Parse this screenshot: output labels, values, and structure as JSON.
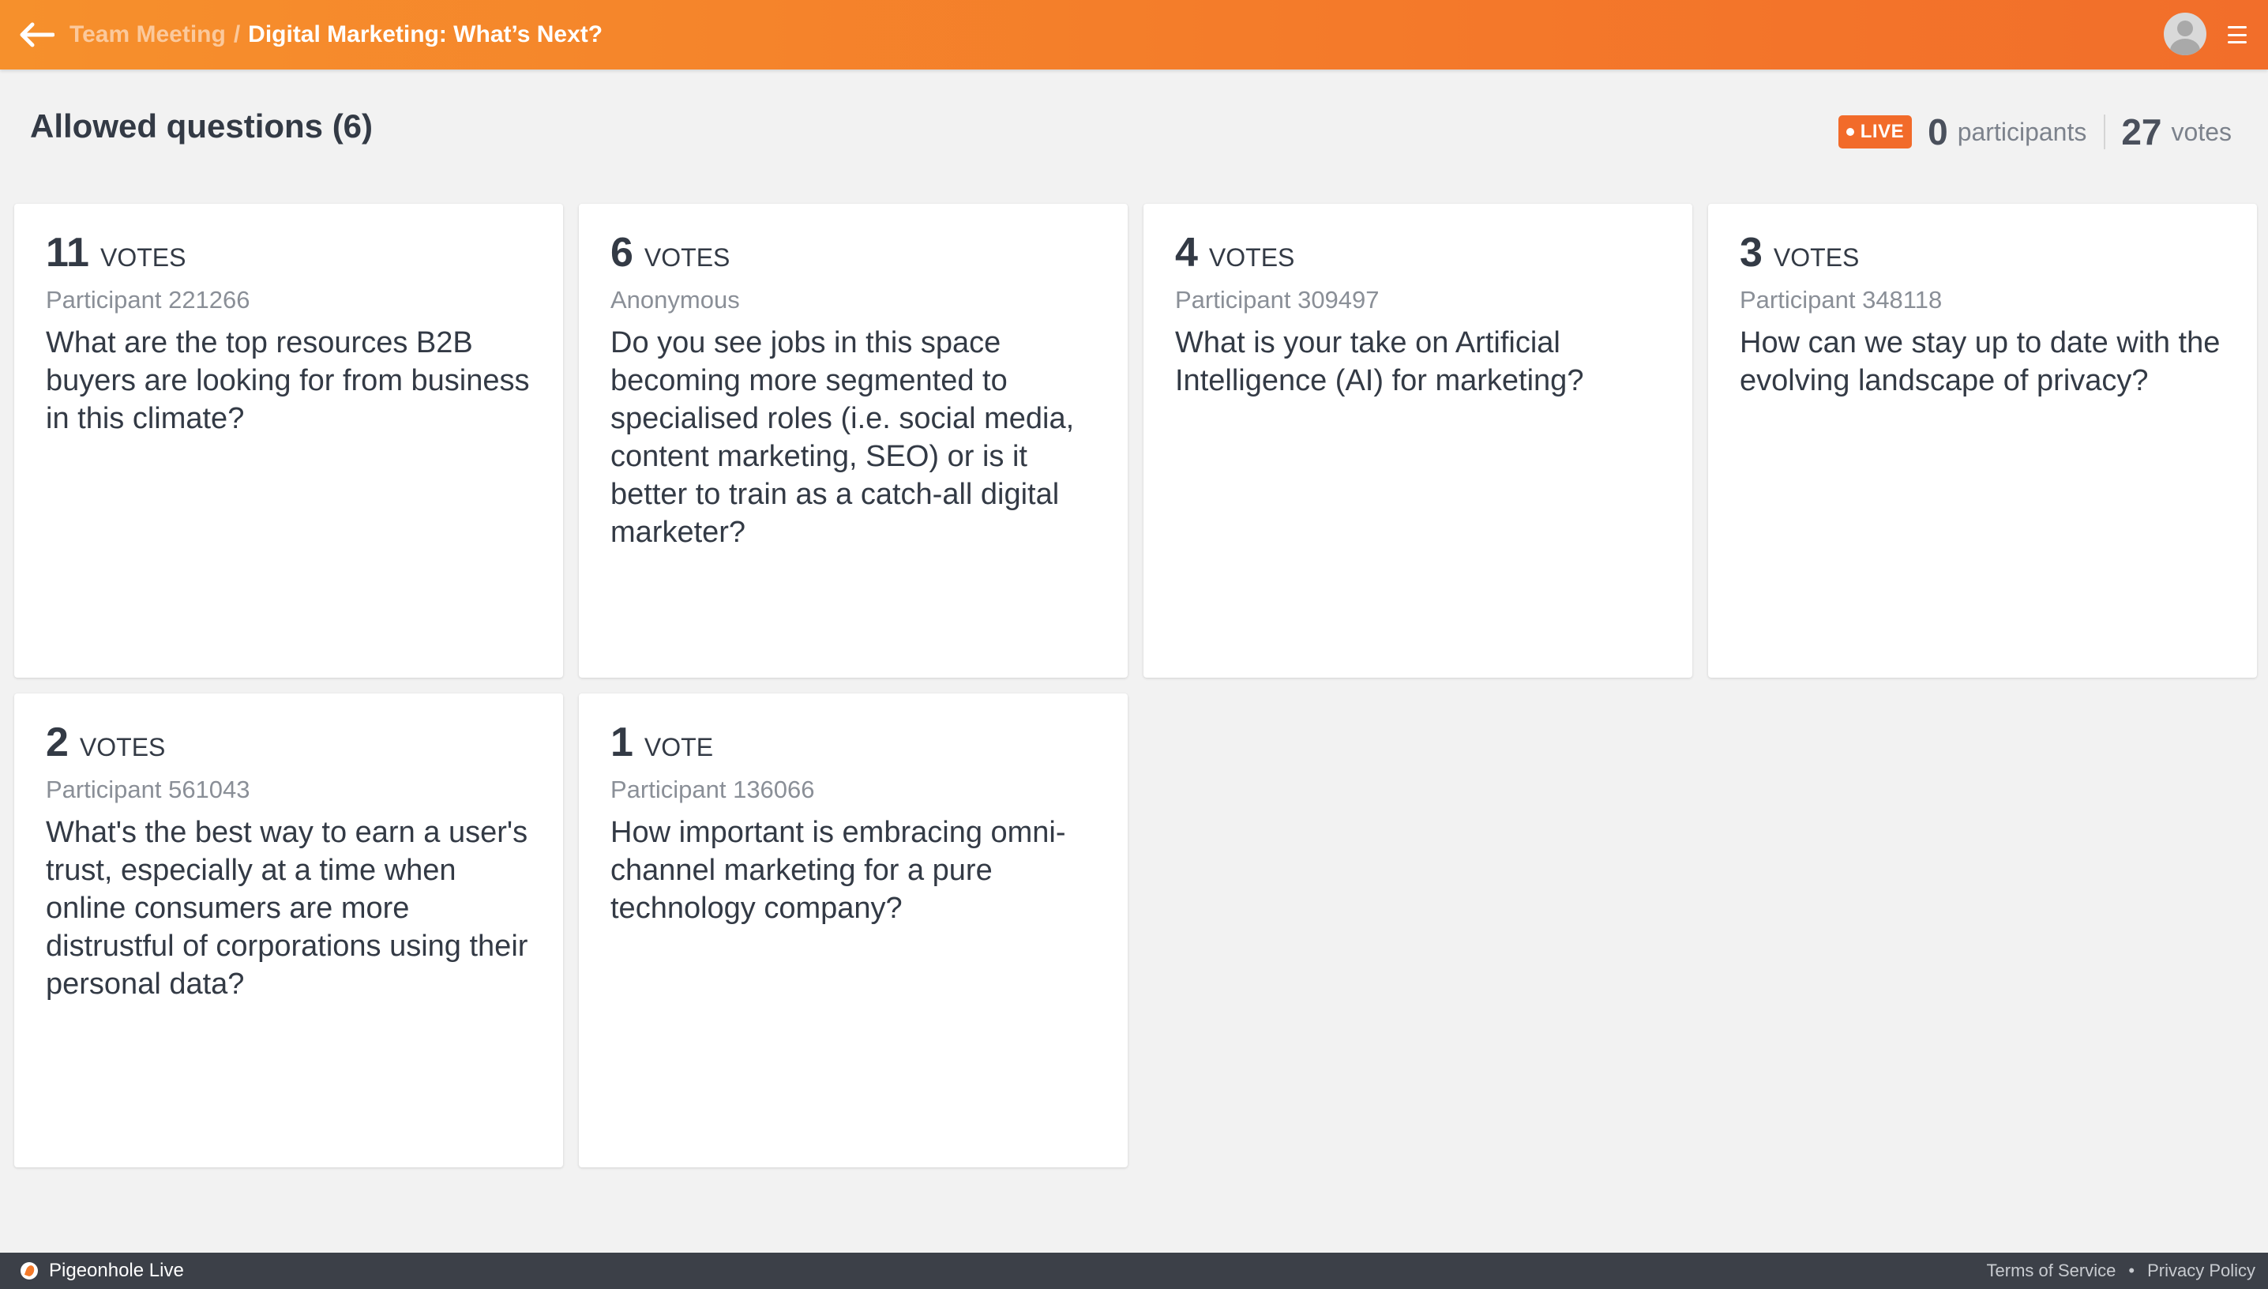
{
  "header": {
    "back_icon": "arrow-left-icon",
    "breadcrumb_parent": "Team Meeting",
    "breadcrumb_separator": "/",
    "breadcrumb_current": "Digital Marketing: What’s Next?",
    "avatar_icon": "user-avatar-icon",
    "menu_icon": "hamburger-menu-icon"
  },
  "section": {
    "title": "Allowed questions (6)"
  },
  "stats": {
    "live_label": "LIVE",
    "participants_count": "0",
    "participants_label": "participants",
    "votes_count": "27",
    "votes_label": "votes"
  },
  "questions": [
    {
      "votes": "11",
      "votes_label": "VOTES",
      "author": "Participant 221266",
      "text": "What are the top resources B2B buyers are looking for from business in this climate?"
    },
    {
      "votes": "6",
      "votes_label": "VOTES",
      "author": "Anonymous",
      "text": "Do you see jobs in this space becoming more segmented to specialised roles (i.e. social media, content marketing, SEO) or is it better to train as a catch-all digital marketer?"
    },
    {
      "votes": "4",
      "votes_label": "VOTES",
      "author": "Participant 309497",
      "text": "What is your take on Artificial Intelligence (AI) for marketing?"
    },
    {
      "votes": "3",
      "votes_label": "VOTES",
      "author": "Participant 348118",
      "text": "How can we stay up to date with the evolving landscape of privacy?"
    },
    {
      "votes": "2",
      "votes_label": "VOTES",
      "author": "Participant 561043",
      "text": "What's the best way to earn a user's trust, especially at a time when online consumers are more distrustful of corporations using their personal data?"
    },
    {
      "votes": "1",
      "votes_label": "VOTE",
      "author": "Participant 136066",
      "text": "How important is embracing omni-channel marketing for a pure technology company?"
    }
  ],
  "footer": {
    "brand": "Pigeonhole Live",
    "terms": "Terms of Service",
    "separator": "•",
    "privacy": "Privacy Policy"
  },
  "colors": {
    "header_accent": "#f47a2a",
    "live_badge": "#f26b2a",
    "footer_bg": "#3c4048"
  }
}
